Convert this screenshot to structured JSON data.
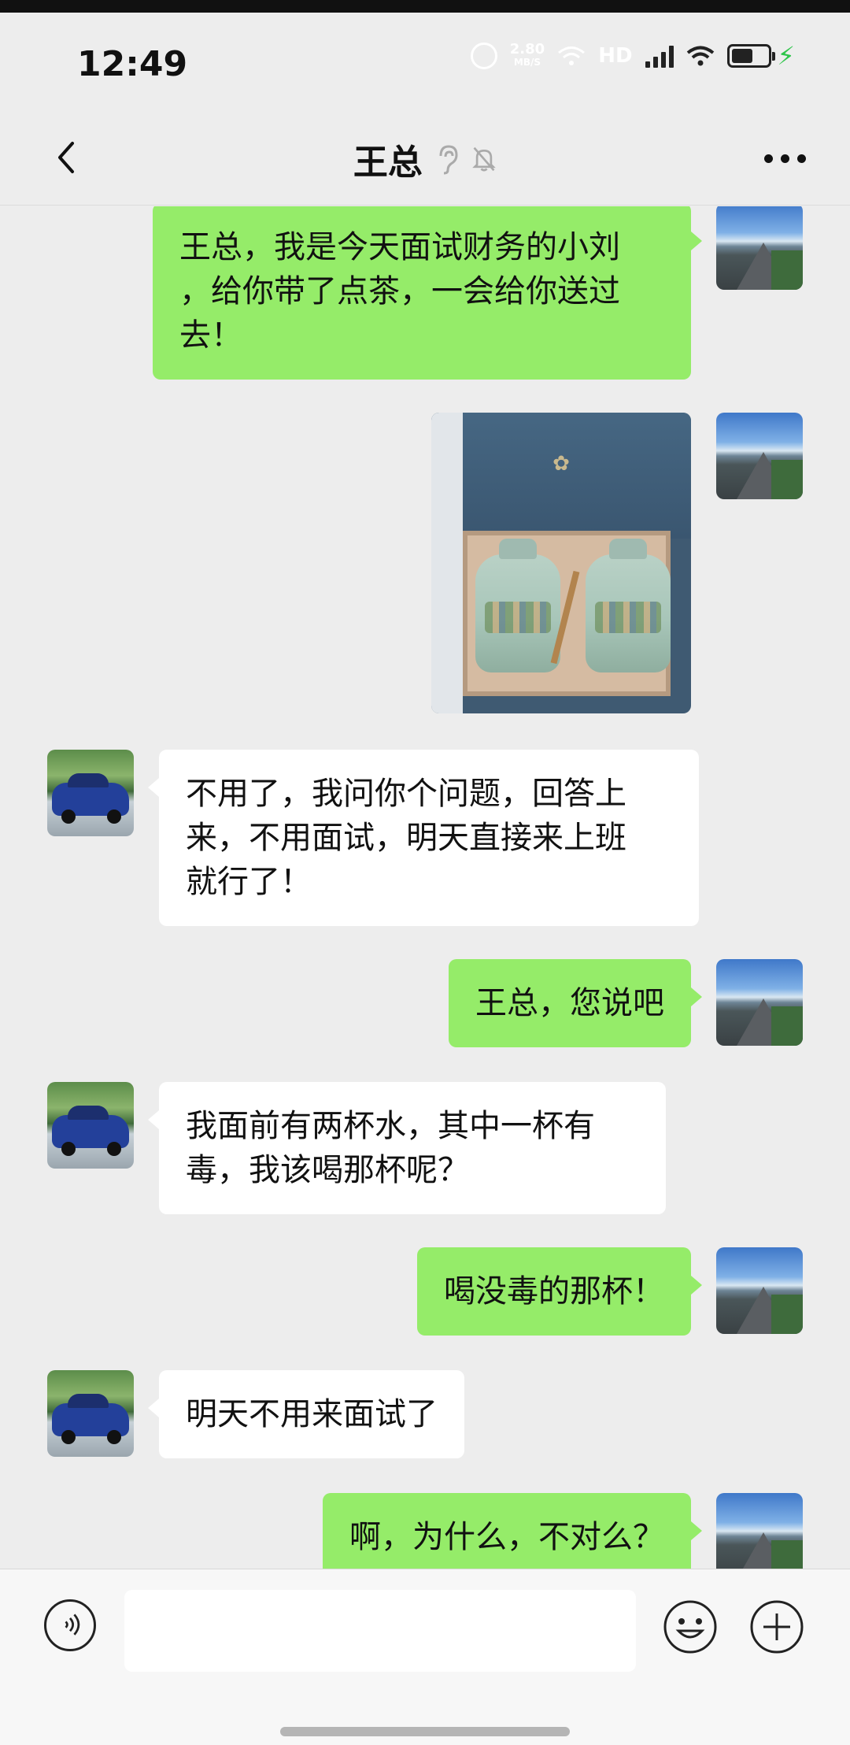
{
  "status_bar": {
    "time": "12:49",
    "network_speed_value": "2.80",
    "network_speed_unit": "MB/S",
    "hd_label": "HD",
    "battery_level_percent": 60
  },
  "nav": {
    "title": "王总",
    "icons": [
      "back-chevron-icon",
      "ear-icon",
      "mute-bell-icon",
      "more-dots-icon"
    ]
  },
  "messages": [
    {
      "from": "me",
      "type": "text",
      "text": "王总，我是今天面试财务的小刘\n，给你带了点茶，一会给你送过\n去！"
    },
    {
      "from": "me",
      "type": "image",
      "description_icon": "tea-gift-box-photo"
    },
    {
      "from": "other",
      "type": "text",
      "text": "不用了，我问你个问题，回答上\n来，不用面试，明天直接来上班\n就行了！"
    },
    {
      "from": "me",
      "type": "text",
      "text": "王总，您说吧"
    },
    {
      "from": "other",
      "type": "text",
      "text": "我面前有两杯水，其中一杯有\n毒，我该喝那杯呢？"
    },
    {
      "from": "me",
      "type": "text",
      "text": "喝没毒的那杯！"
    },
    {
      "from": "other",
      "type": "text",
      "text": "明天不用来面试了"
    },
    {
      "from": "me",
      "type": "text",
      "text": "啊，为什么，不对么？"
    }
  ],
  "input_bar": {
    "text_value": "",
    "icons": [
      "voice-icon",
      "emoji-icon",
      "plus-icon"
    ]
  },
  "colors": {
    "my_bubble": "#95ec69",
    "other_bubble": "#ffffff",
    "background": "#ededed"
  }
}
